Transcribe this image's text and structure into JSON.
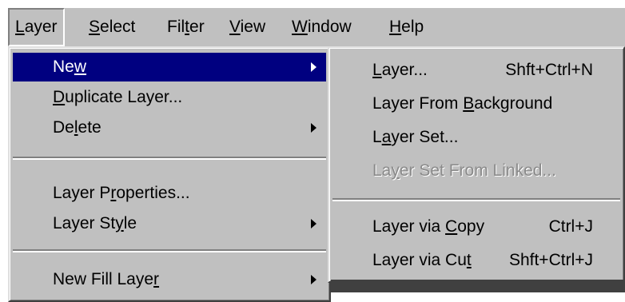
{
  "menubar": {
    "items": [
      {
        "pre": "",
        "acc": "L",
        "post": "ayer"
      },
      {
        "pre": "",
        "acc": "S",
        "post": "elect"
      },
      {
        "pre": "Fil",
        "acc": "t",
        "post": "er"
      },
      {
        "pre": "",
        "acc": "V",
        "post": "iew"
      },
      {
        "pre": "",
        "acc": "W",
        "post": "indow"
      },
      {
        "pre": "",
        "acc": "H",
        "post": "elp"
      }
    ]
  },
  "layer_menu": {
    "new": {
      "pre": "Ne",
      "acc": "w",
      "post": ""
    },
    "duplicate": {
      "pre": "",
      "acc": "D",
      "post": "uplicate Layer..."
    },
    "delete": {
      "pre": "De",
      "acc": "l",
      "post": "ete"
    },
    "properties": {
      "pre": "Layer P",
      "acc": "r",
      "post": "operties..."
    },
    "style": {
      "pre": "Layer St",
      "acc": "y",
      "post": "le"
    },
    "new_fill": {
      "pre": "New Fill Laye",
      "acc": "r",
      "post": ""
    }
  },
  "new_submenu": {
    "layer": {
      "pre": "",
      "acc": "L",
      "post": "ayer...",
      "shortcut": "Shft+Ctrl+N"
    },
    "from_background": {
      "pre": "Layer From ",
      "acc": "B",
      "post": "ackground"
    },
    "layer_set": {
      "pre": "L",
      "acc": "a",
      "post": "yer Set..."
    },
    "set_from_linked": {
      "pre": "La",
      "acc": "y",
      "post": "er Set From Linked..."
    },
    "via_copy": {
      "pre": "Layer via ",
      "acc": "C",
      "post": "opy",
      "shortcut": "Ctrl+J"
    },
    "via_cut": {
      "pre": "Layer via Cu",
      "acc": "t",
      "post": "",
      "shortcut": "Shft+Ctrl+J"
    }
  }
}
